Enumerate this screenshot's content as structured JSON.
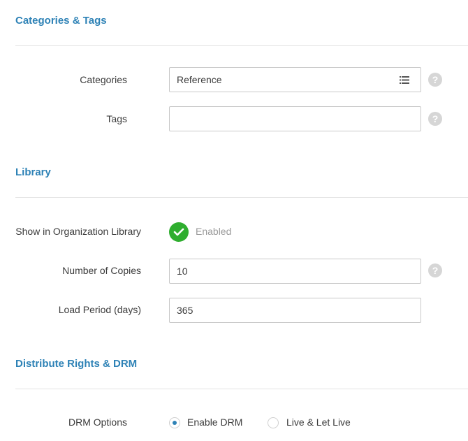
{
  "colors": {
    "section_title": "#2e82b6",
    "enabled_green": "#2fae2f",
    "help_gray": "#d6d6d6",
    "radio_accent": "#2e82b6"
  },
  "categories_tags": {
    "title": "Categories & Tags",
    "categories_label": "Categories",
    "categories_value": "Reference",
    "categories_icon": "list-icon",
    "tags_label": "Tags",
    "tags_value": ""
  },
  "library": {
    "title": "Library",
    "show_label": "Show in Organization Library",
    "show_status": "Enabled",
    "copies_label": "Number of Copies",
    "copies_value": "10",
    "load_label": "Load Period (days)",
    "load_value": "365"
  },
  "drm": {
    "title": "Distribute Rights & DRM",
    "options_label": "DRM Options",
    "options": [
      {
        "label": "Enable DRM",
        "selected": true
      },
      {
        "label": "Live & Let Live",
        "selected": false
      }
    ]
  },
  "help_glyph": "?"
}
